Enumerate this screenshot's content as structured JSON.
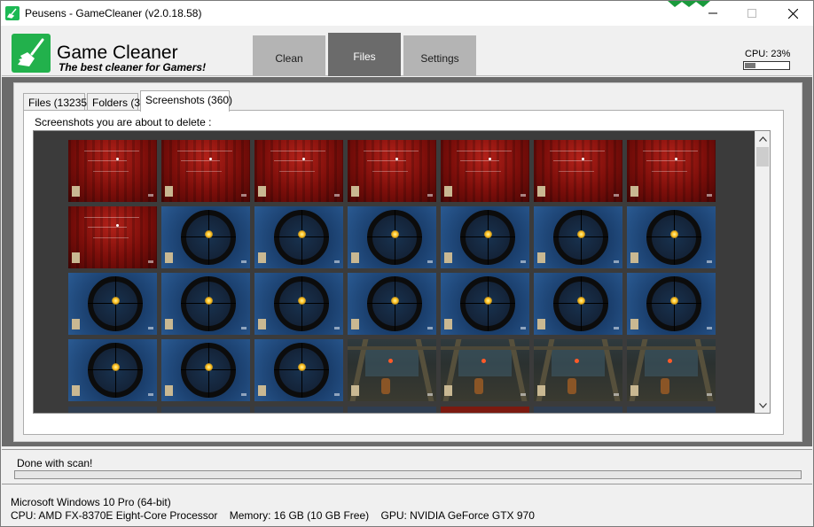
{
  "window": {
    "title": "Peusens - GameCleaner (v2.0.18.58)"
  },
  "header": {
    "brand_name": "Game Cleaner",
    "brand_tagline": "The best cleaner for Gamers!",
    "tabs": [
      {
        "label": "Clean",
        "active": false
      },
      {
        "label": "Files",
        "active": true
      },
      {
        "label": "Settings",
        "active": false
      }
    ],
    "cpu_label": "CPU: 23%",
    "cpu_percent": 23,
    "accent_color": "#22b14c"
  },
  "main": {
    "subtabs": [
      {
        "label": "Files (13235)",
        "active": false
      },
      {
        "label": "Folders (3)",
        "active": false
      },
      {
        "label": "Screenshots (360)",
        "active": true
      }
    ],
    "about_label": "Screenshots you are about to delete :",
    "thumbnail_rows": [
      [
        "menu",
        "menu",
        "menu",
        "menu",
        "menu",
        "menu",
        "menu"
      ],
      [
        "menu",
        "scope",
        "scope",
        "scope",
        "scope",
        "scope",
        "scope"
      ],
      [
        "scope",
        "scope",
        "scope",
        "scope",
        "scope",
        "scope",
        "scope"
      ],
      [
        "scope",
        "scope",
        "scope",
        "scene",
        "scene",
        "scene",
        "scene"
      ]
    ]
  },
  "status": {
    "text": "Done with scan!",
    "progress_percent": 0,
    "progress_color": "#06b025"
  },
  "system": {
    "os": "Microsoft Windows 10 Pro (64-bit)",
    "cpu": "CPU: AMD FX-8370E Eight-Core Processor",
    "memory": "Memory: 16 GB (10 GB Free)",
    "gpu": "GPU: NVIDIA GeForce GTX 970"
  }
}
